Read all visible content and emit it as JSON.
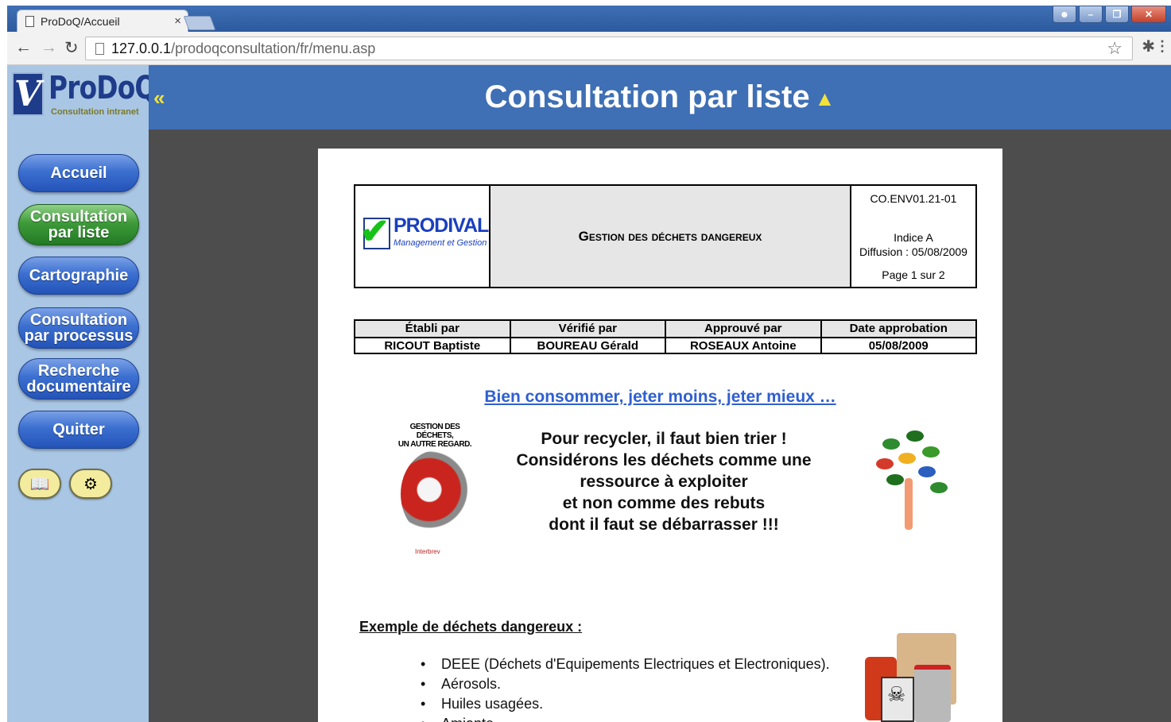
{
  "browser": {
    "tab_title": "ProDoQ/Accueil",
    "tab_close": "×",
    "url_host": "127.0.0.1",
    "url_path": "/prodoqconsultation/fr/menu.asp"
  },
  "sidebar": {
    "logo_name": "ProDoQ",
    "logo_letter": "V",
    "logo_sub": "Consultation intranet",
    "items": [
      {
        "line1": "Accueil",
        "line2": "",
        "active": false
      },
      {
        "line1": "Consultation",
        "line2": "par liste",
        "active": true
      },
      {
        "line1": "Cartographie",
        "line2": "",
        "active": false
      },
      {
        "line1": "Consultation",
        "line2": "par processus",
        "active": false
      },
      {
        "line1": "Recherche",
        "line2": "documentaire",
        "active": false
      },
      {
        "line1": "Quitter",
        "line2": "",
        "active": false
      }
    ],
    "icons": [
      "book-icon",
      "settings-icon"
    ]
  },
  "header": {
    "title": "Consultation par liste"
  },
  "document": {
    "company_name": "PRODIVAL",
    "company_tagline": "Management et Gestion",
    "doc_title": "Gestion des déchets dangereux",
    "doc_ref": "CO.ENV01.21-01",
    "doc_index": "Indice A",
    "doc_diffusion": "Diffusion : 05/08/2009",
    "doc_page": "Page 1 sur 2",
    "sig_headers": [
      "Établi par",
      "Vérifié par",
      "Approuvé par",
      "Date approbation"
    ],
    "sig_values": [
      "RICOUT Baptiste",
      "BOUREAU Gérald",
      "ROSEAUX Antoine",
      "05/08/2009"
    ],
    "slogan": "Bien consommer, jeter moins, jeter mieux …",
    "image_caption_line1": "GESTION DES DÉCHETS,",
    "image_caption_line2": "UN AUTRE REGARD.",
    "image_small": "Interbrev",
    "message": [
      "Pour recycler, il faut bien trier !",
      "Considérons les déchets comme une",
      "ressource à exploiter",
      "et non comme des rebuts",
      "dont il faut se débarrasser !!!"
    ],
    "examples_heading": "Exemple de déchets dangereux :",
    "examples": [
      "DEEE (Déchets d'Equipements Electriques et Electroniques).",
      "Aérosols.",
      "Huiles usagées.",
      "Amiante"
    ]
  }
}
